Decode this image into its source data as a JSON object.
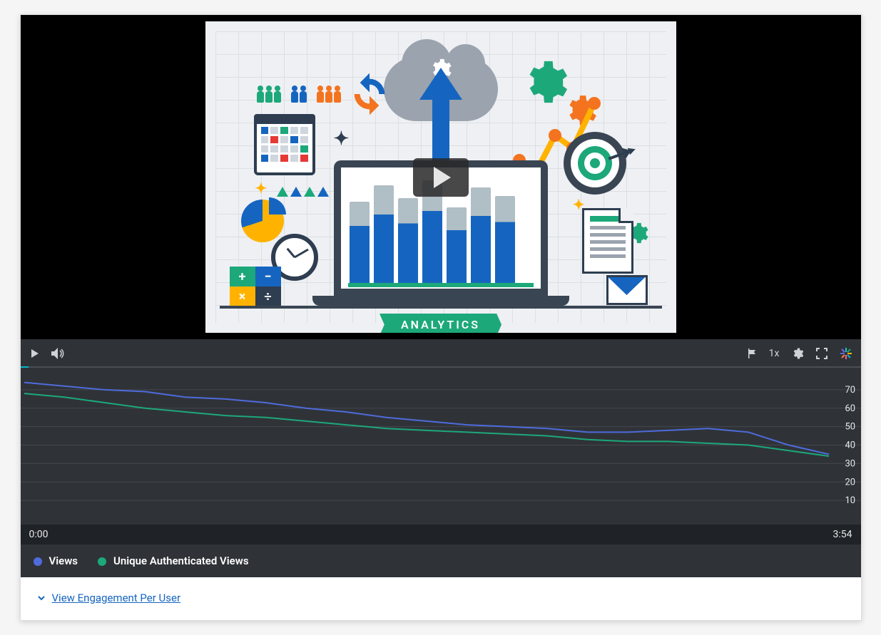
{
  "thumbnail": {
    "banner_text": "ANALYTICS"
  },
  "player": {
    "speed_label": "1x"
  },
  "time": {
    "start": "0:00",
    "end": "3:54"
  },
  "legend": {
    "series_a": "Views",
    "series_b": "Unique Authenticated Views"
  },
  "expand": {
    "label": "View Engagement Per User"
  },
  "chart_data": {
    "type": "line",
    "title": "",
    "xlabel": "",
    "ylabel": "",
    "x_range": [
      "0:00",
      "3:54"
    ],
    "ylim": [
      0,
      75
    ],
    "y_ticks": [
      10,
      20,
      30,
      40,
      50,
      60,
      70
    ],
    "x": [
      0,
      5,
      10,
      15,
      20,
      25,
      30,
      35,
      40,
      45,
      50,
      55,
      60,
      65,
      70,
      75,
      80,
      85,
      90,
      95,
      100
    ],
    "series": [
      {
        "name": "Views",
        "color": "#4f6bdc",
        "values": [
          74,
          72,
          70,
          69,
          66,
          65,
          63,
          60,
          58,
          55,
          53,
          51,
          50,
          49,
          47,
          47,
          48,
          49,
          47,
          40,
          35
        ]
      },
      {
        "name": "Unique Authenticated Views",
        "color": "#1da87a",
        "values": [
          68,
          66,
          63,
          60,
          58,
          56,
          55,
          53,
          51,
          49,
          48,
          47,
          46,
          45,
          43,
          42,
          42,
          41,
          40,
          37,
          34
        ]
      }
    ]
  }
}
